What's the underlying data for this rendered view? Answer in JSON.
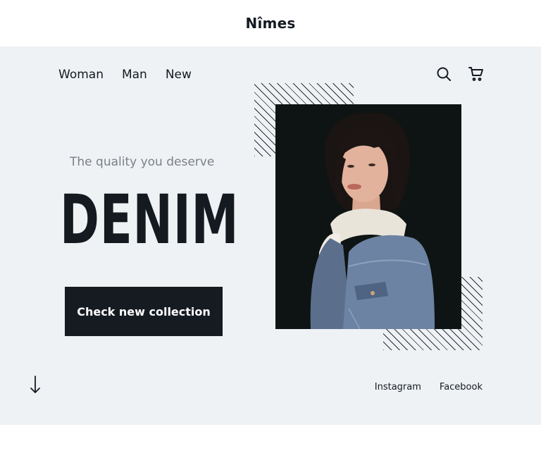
{
  "header": {
    "brand": "Nîmes"
  },
  "nav": {
    "items": [
      "Woman",
      "Man",
      "New"
    ]
  },
  "hero": {
    "tagline": "The quality you deserve",
    "headline": "DENIM",
    "cta_label": "Check new collection"
  },
  "social": {
    "instagram": "Instagram",
    "facebook": "Facebook"
  },
  "icons": {
    "search": "search-icon",
    "cart": "cart-icon",
    "scroll": "arrow-down-icon"
  },
  "colors": {
    "background": "#eff2f4",
    "text": "#141a20",
    "muted": "#7b8088",
    "button": "#161b22"
  }
}
